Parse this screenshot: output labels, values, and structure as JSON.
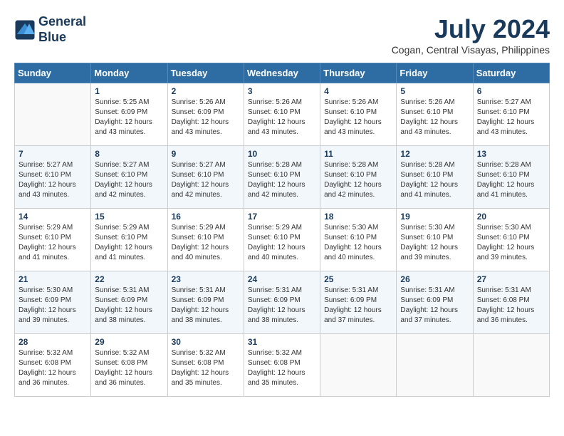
{
  "header": {
    "logo_line1": "General",
    "logo_line2": "Blue",
    "month_year": "July 2024",
    "location": "Cogan, Central Visayas, Philippines"
  },
  "days_of_week": [
    "Sunday",
    "Monday",
    "Tuesday",
    "Wednesday",
    "Thursday",
    "Friday",
    "Saturday"
  ],
  "weeks": [
    [
      {
        "day": "",
        "sunrise": "",
        "sunset": "",
        "daylight": ""
      },
      {
        "day": "1",
        "sunrise": "Sunrise: 5:25 AM",
        "sunset": "Sunset: 6:09 PM",
        "daylight": "Daylight: 12 hours and 43 minutes."
      },
      {
        "day": "2",
        "sunrise": "Sunrise: 5:26 AM",
        "sunset": "Sunset: 6:09 PM",
        "daylight": "Daylight: 12 hours and 43 minutes."
      },
      {
        "day": "3",
        "sunrise": "Sunrise: 5:26 AM",
        "sunset": "Sunset: 6:10 PM",
        "daylight": "Daylight: 12 hours and 43 minutes."
      },
      {
        "day": "4",
        "sunrise": "Sunrise: 5:26 AM",
        "sunset": "Sunset: 6:10 PM",
        "daylight": "Daylight: 12 hours and 43 minutes."
      },
      {
        "day": "5",
        "sunrise": "Sunrise: 5:26 AM",
        "sunset": "Sunset: 6:10 PM",
        "daylight": "Daylight: 12 hours and 43 minutes."
      },
      {
        "day": "6",
        "sunrise": "Sunrise: 5:27 AM",
        "sunset": "Sunset: 6:10 PM",
        "daylight": "Daylight: 12 hours and 43 minutes."
      }
    ],
    [
      {
        "day": "7",
        "sunrise": "Sunrise: 5:27 AM",
        "sunset": "Sunset: 6:10 PM",
        "daylight": "Daylight: 12 hours and 43 minutes."
      },
      {
        "day": "8",
        "sunrise": "Sunrise: 5:27 AM",
        "sunset": "Sunset: 6:10 PM",
        "daylight": "Daylight: 12 hours and 42 minutes."
      },
      {
        "day": "9",
        "sunrise": "Sunrise: 5:27 AM",
        "sunset": "Sunset: 6:10 PM",
        "daylight": "Daylight: 12 hours and 42 minutes."
      },
      {
        "day": "10",
        "sunrise": "Sunrise: 5:28 AM",
        "sunset": "Sunset: 6:10 PM",
        "daylight": "Daylight: 12 hours and 42 minutes."
      },
      {
        "day": "11",
        "sunrise": "Sunrise: 5:28 AM",
        "sunset": "Sunset: 6:10 PM",
        "daylight": "Daylight: 12 hours and 42 minutes."
      },
      {
        "day": "12",
        "sunrise": "Sunrise: 5:28 AM",
        "sunset": "Sunset: 6:10 PM",
        "daylight": "Daylight: 12 hours and 41 minutes."
      },
      {
        "day": "13",
        "sunrise": "Sunrise: 5:28 AM",
        "sunset": "Sunset: 6:10 PM",
        "daylight": "Daylight: 12 hours and 41 minutes."
      }
    ],
    [
      {
        "day": "14",
        "sunrise": "Sunrise: 5:29 AM",
        "sunset": "Sunset: 6:10 PM",
        "daylight": "Daylight: 12 hours and 41 minutes."
      },
      {
        "day": "15",
        "sunrise": "Sunrise: 5:29 AM",
        "sunset": "Sunset: 6:10 PM",
        "daylight": "Daylight: 12 hours and 41 minutes."
      },
      {
        "day": "16",
        "sunrise": "Sunrise: 5:29 AM",
        "sunset": "Sunset: 6:10 PM",
        "daylight": "Daylight: 12 hours and 40 minutes."
      },
      {
        "day": "17",
        "sunrise": "Sunrise: 5:29 AM",
        "sunset": "Sunset: 6:10 PM",
        "daylight": "Daylight: 12 hours and 40 minutes."
      },
      {
        "day": "18",
        "sunrise": "Sunrise: 5:30 AM",
        "sunset": "Sunset: 6:10 PM",
        "daylight": "Daylight: 12 hours and 40 minutes."
      },
      {
        "day": "19",
        "sunrise": "Sunrise: 5:30 AM",
        "sunset": "Sunset: 6:10 PM",
        "daylight": "Daylight: 12 hours and 39 minutes."
      },
      {
        "day": "20",
        "sunrise": "Sunrise: 5:30 AM",
        "sunset": "Sunset: 6:10 PM",
        "daylight": "Daylight: 12 hours and 39 minutes."
      }
    ],
    [
      {
        "day": "21",
        "sunrise": "Sunrise: 5:30 AM",
        "sunset": "Sunset: 6:09 PM",
        "daylight": "Daylight: 12 hours and 39 minutes."
      },
      {
        "day": "22",
        "sunrise": "Sunrise: 5:31 AM",
        "sunset": "Sunset: 6:09 PM",
        "daylight": "Daylight: 12 hours and 38 minutes."
      },
      {
        "day": "23",
        "sunrise": "Sunrise: 5:31 AM",
        "sunset": "Sunset: 6:09 PM",
        "daylight": "Daylight: 12 hours and 38 minutes."
      },
      {
        "day": "24",
        "sunrise": "Sunrise: 5:31 AM",
        "sunset": "Sunset: 6:09 PM",
        "daylight": "Daylight: 12 hours and 38 minutes."
      },
      {
        "day": "25",
        "sunrise": "Sunrise: 5:31 AM",
        "sunset": "Sunset: 6:09 PM",
        "daylight": "Daylight: 12 hours and 37 minutes."
      },
      {
        "day": "26",
        "sunrise": "Sunrise: 5:31 AM",
        "sunset": "Sunset: 6:09 PM",
        "daylight": "Daylight: 12 hours and 37 minutes."
      },
      {
        "day": "27",
        "sunrise": "Sunrise: 5:31 AM",
        "sunset": "Sunset: 6:08 PM",
        "daylight": "Daylight: 12 hours and 36 minutes."
      }
    ],
    [
      {
        "day": "28",
        "sunrise": "Sunrise: 5:32 AM",
        "sunset": "Sunset: 6:08 PM",
        "daylight": "Daylight: 12 hours and 36 minutes."
      },
      {
        "day": "29",
        "sunrise": "Sunrise: 5:32 AM",
        "sunset": "Sunset: 6:08 PM",
        "daylight": "Daylight: 12 hours and 36 minutes."
      },
      {
        "day": "30",
        "sunrise": "Sunrise: 5:32 AM",
        "sunset": "Sunset: 6:08 PM",
        "daylight": "Daylight: 12 hours and 35 minutes."
      },
      {
        "day": "31",
        "sunrise": "Sunrise: 5:32 AM",
        "sunset": "Sunset: 6:08 PM",
        "daylight": "Daylight: 12 hours and 35 minutes."
      },
      {
        "day": "",
        "sunrise": "",
        "sunset": "",
        "daylight": ""
      },
      {
        "day": "",
        "sunrise": "",
        "sunset": "",
        "daylight": ""
      },
      {
        "day": "",
        "sunrise": "",
        "sunset": "",
        "daylight": ""
      }
    ]
  ]
}
